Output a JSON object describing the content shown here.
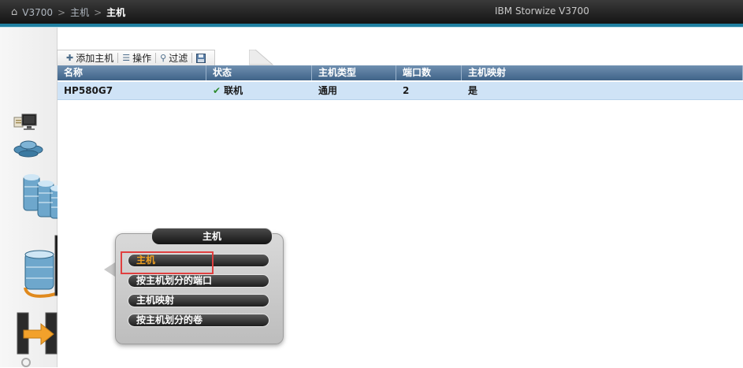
{
  "breadcrumb": {
    "home_icon": "home-icon",
    "root": "V3700",
    "separator": ">",
    "parent": "主机",
    "current": "主机"
  },
  "product_name": "IBM Storwize V3700",
  "toolbar": {
    "add_host": "添加主机",
    "actions": "操作",
    "filter": "过滤",
    "save_icon": "save-icon"
  },
  "table": {
    "columns": [
      "名称",
      "状态",
      "主机类型",
      "端口数",
      "主机映射"
    ],
    "rows": [
      {
        "name": "HP580G7",
        "status": "联机",
        "host_type": "通用",
        "ports": "2",
        "mapped": "是"
      }
    ]
  },
  "popup": {
    "title": "主机",
    "items": [
      "主机",
      "按主机划分的端口",
      "主机映射",
      "按主机划分的卷"
    ]
  },
  "colors": {
    "accent": "#1f7fa0",
    "header": "#4f7398",
    "row_selected": "#cfe3f6",
    "active_item": "#f0a020",
    "highlight": "#e04040"
  }
}
